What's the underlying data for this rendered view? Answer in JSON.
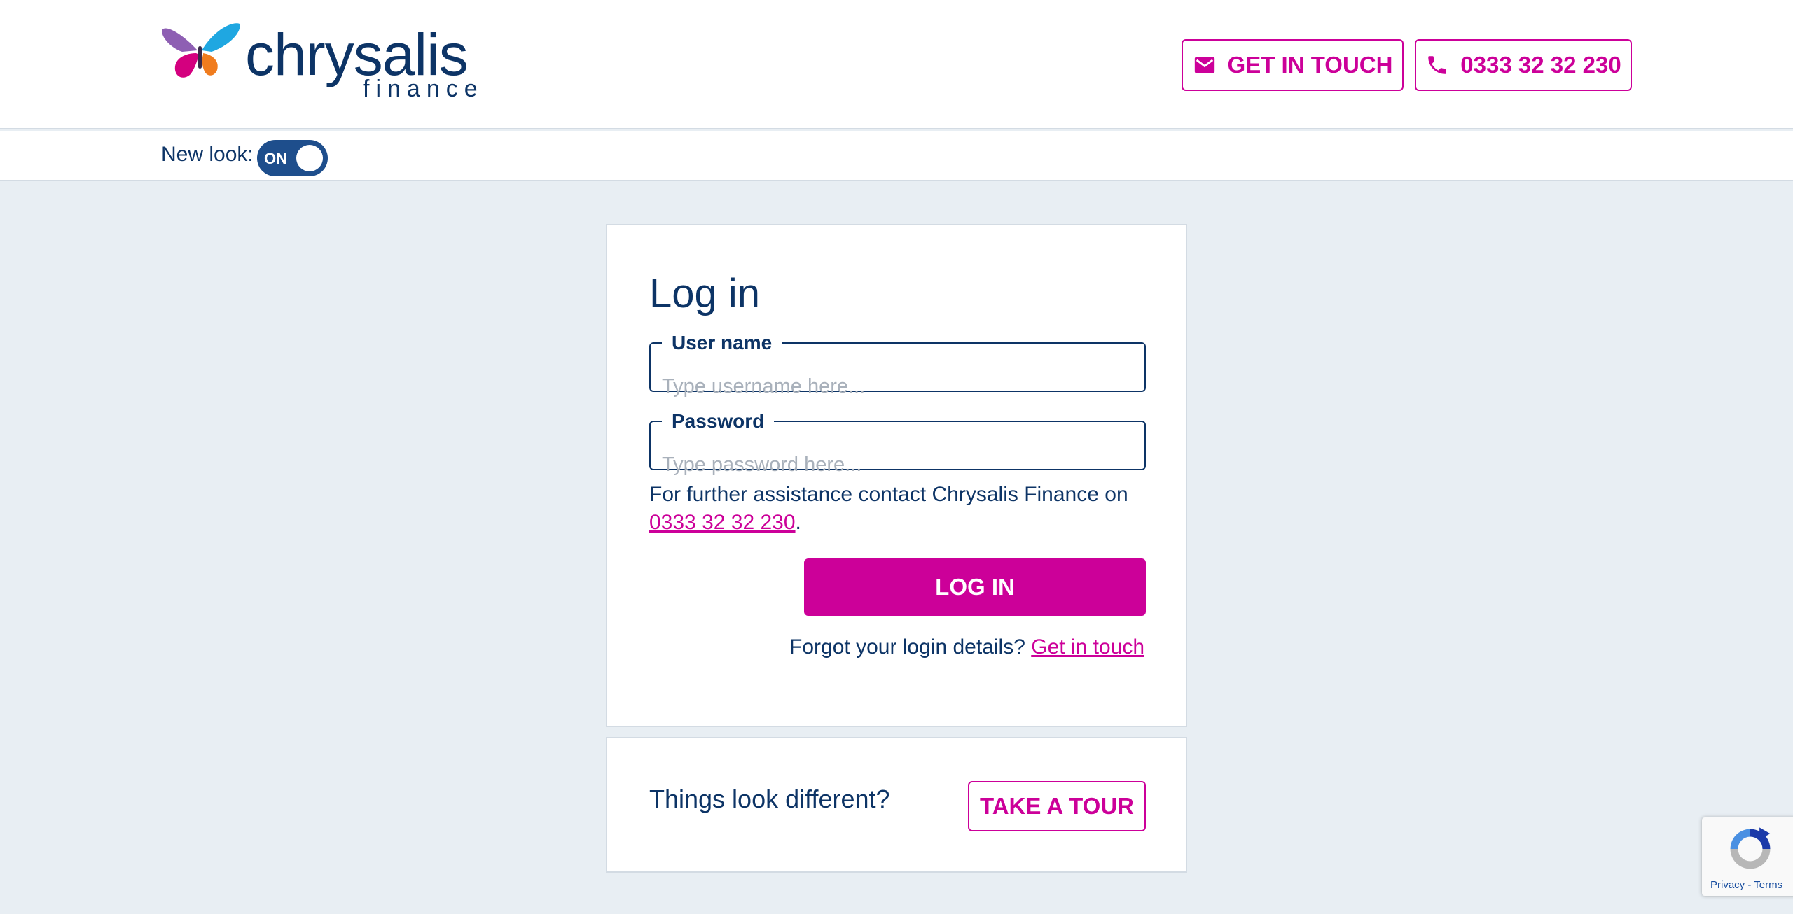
{
  "brand": {
    "name": "chrysalis",
    "subname": "finance",
    "colors": {
      "primary": "#0d3466",
      "accent": "#cc0099",
      "background": "#e8eef3"
    }
  },
  "header": {
    "get_in_touch": {
      "label": "GET IN TOUCH",
      "icon": "envelope-icon"
    },
    "phone": {
      "label": "0333 32 32 230",
      "icon": "phone-icon"
    }
  },
  "subbar": {
    "new_look_label": "New look:",
    "toggle_text": "ON"
  },
  "login": {
    "title": "Log in",
    "username": {
      "label": "User name",
      "placeholder": "Type username here...",
      "value": ""
    },
    "password": {
      "label": "Password",
      "placeholder": "Type password here...",
      "value": ""
    },
    "assist_text": "For further assistance contact Chrysalis Finance on",
    "assist_phone": "0333 32 32 230",
    "assist_end": ".",
    "button": "LOG IN",
    "forgot_text": "Forgot your login details?",
    "forgot_link": "Get in touch"
  },
  "tour": {
    "text": "Things look different?",
    "button": "TAKE A TOUR"
  },
  "recaptcha": {
    "privacy": "Privacy",
    "separator": " - ",
    "terms": "Terms"
  }
}
